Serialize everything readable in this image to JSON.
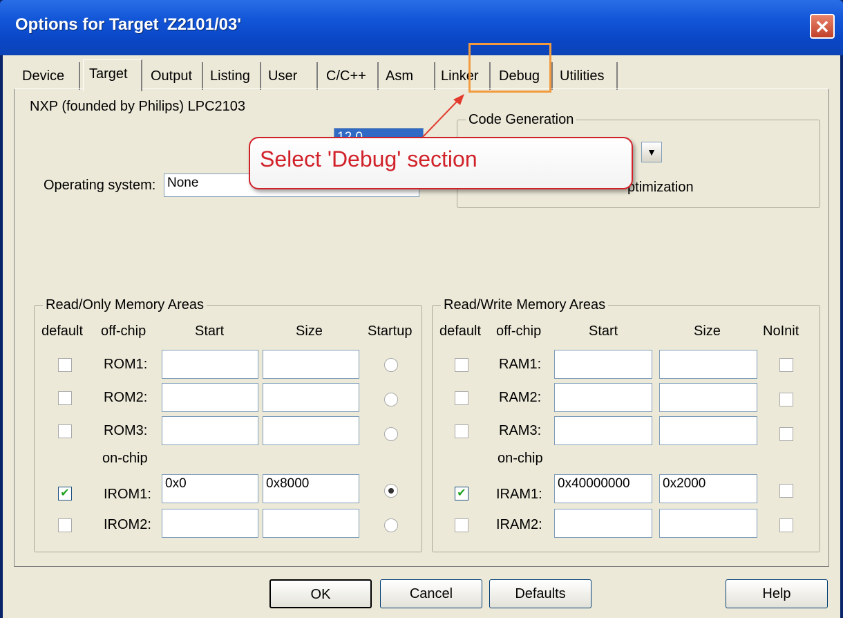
{
  "window": {
    "title": "Options for Target 'Z2101/03'",
    "close_glyph": "✕"
  },
  "tabs": [
    {
      "label": "Device"
    },
    {
      "label": "Target"
    },
    {
      "label": "Output"
    },
    {
      "label": "Listing"
    },
    {
      "label": "User"
    },
    {
      "label": "C/C++"
    },
    {
      "label": "Asm"
    },
    {
      "label": "Linker"
    },
    {
      "label": "Debug"
    },
    {
      "label": "Utilities"
    }
  ],
  "active_tab": "Target",
  "target": {
    "device_label": "NXP (founded by Philips) LPC2103",
    "xtal_value": "12.0",
    "os_label": "Operating system:",
    "os_value": "None",
    "code_generation_legend": "Code Generation",
    "optimization_text": "ptimization"
  },
  "callout": {
    "text": "Select 'Debug' section",
    "color": "#d1222a",
    "highlight_color": "#f29a3e"
  },
  "rom": {
    "legend": "Read/Only Memory Areas",
    "headers": {
      "default": "default",
      "offchip": "off-chip",
      "start": "Start",
      "size": "Size",
      "startup": "Startup"
    },
    "onchip_label": "on-chip",
    "rows": [
      {
        "name": "ROM1:",
        "default": false,
        "start": "",
        "size": "",
        "startup": false
      },
      {
        "name": "ROM2:",
        "default": false,
        "start": "",
        "size": "",
        "startup": false
      },
      {
        "name": "ROM3:",
        "default": false,
        "start": "",
        "size": "",
        "startup": false
      },
      {
        "name": "IROM1:",
        "default": true,
        "start": "0x0",
        "size": "0x8000",
        "startup": true
      },
      {
        "name": "IROM2:",
        "default": false,
        "start": "",
        "size": "",
        "startup": false
      }
    ]
  },
  "ram": {
    "legend": "Read/Write Memory Areas",
    "headers": {
      "default": "default",
      "offchip": "off-chip",
      "start": "Start",
      "size": "Size",
      "noinit": "NoInit"
    },
    "onchip_label": "on-chip",
    "rows": [
      {
        "name": "RAM1:",
        "default": false,
        "start": "",
        "size": "",
        "noinit": false
      },
      {
        "name": "RAM2:",
        "default": false,
        "start": "",
        "size": "",
        "noinit": false
      },
      {
        "name": "RAM3:",
        "default": false,
        "start": "",
        "size": "",
        "noinit": false
      },
      {
        "name": "IRAM1:",
        "default": true,
        "start": "0x40000000",
        "size": "0x2000",
        "noinit": false
      },
      {
        "name": "IRAM2:",
        "default": false,
        "start": "",
        "size": "",
        "noinit": false
      }
    ]
  },
  "buttons": {
    "ok": "OK",
    "cancel": "Cancel",
    "defaults": "Defaults",
    "help": "Help"
  },
  "check_glyph": "✔"
}
